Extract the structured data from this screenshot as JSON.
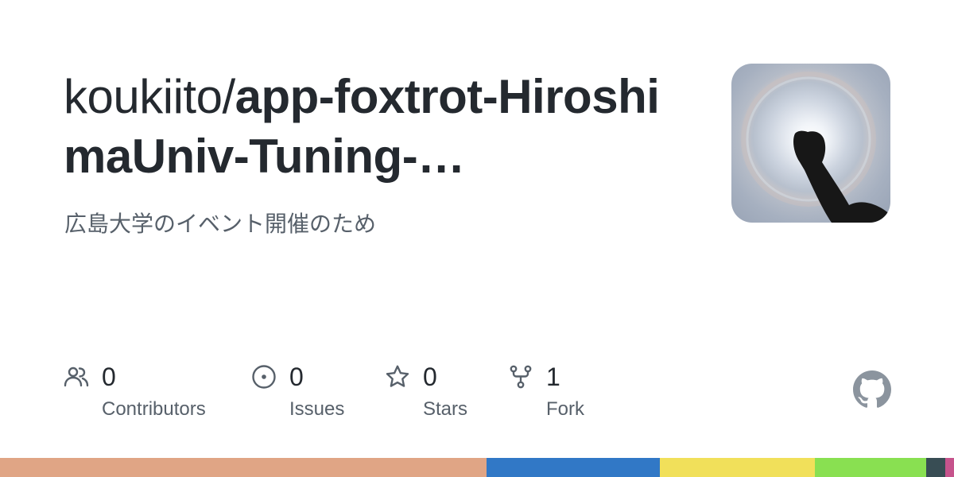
{
  "repo": {
    "owner": "koukiito/",
    "name": "app-foxtrot-HiroshimaUniv-Tuning-…",
    "description": "広島大学のイベント開催のため"
  },
  "stats": {
    "contributors": {
      "value": "0",
      "label": "Contributors",
      "icon": "people-icon"
    },
    "issues": {
      "value": "0",
      "label": "Issues",
      "icon": "issue-opened-icon"
    },
    "stars": {
      "value": "0",
      "label": "Stars",
      "icon": "star-icon"
    },
    "forks": {
      "value": "1",
      "label": "Fork",
      "icon": "repo-forked-icon"
    }
  },
  "language_bar": [
    {
      "color": "#e0a585",
      "share": 51
    },
    {
      "color": "#3178c6",
      "share": 18.2
    },
    {
      "color": "#f1e05a",
      "share": 16.2
    },
    {
      "color": "#89e051",
      "share": 11.7
    },
    {
      "color": "#384d54",
      "share": 2
    },
    {
      "color": "#c6538c",
      "share": 0.9
    }
  ],
  "colors": {
    "text_primary": "#24292f",
    "text_secondary": "#57606a",
    "icon": "#57606a",
    "github_mark": "#8b949e"
  }
}
